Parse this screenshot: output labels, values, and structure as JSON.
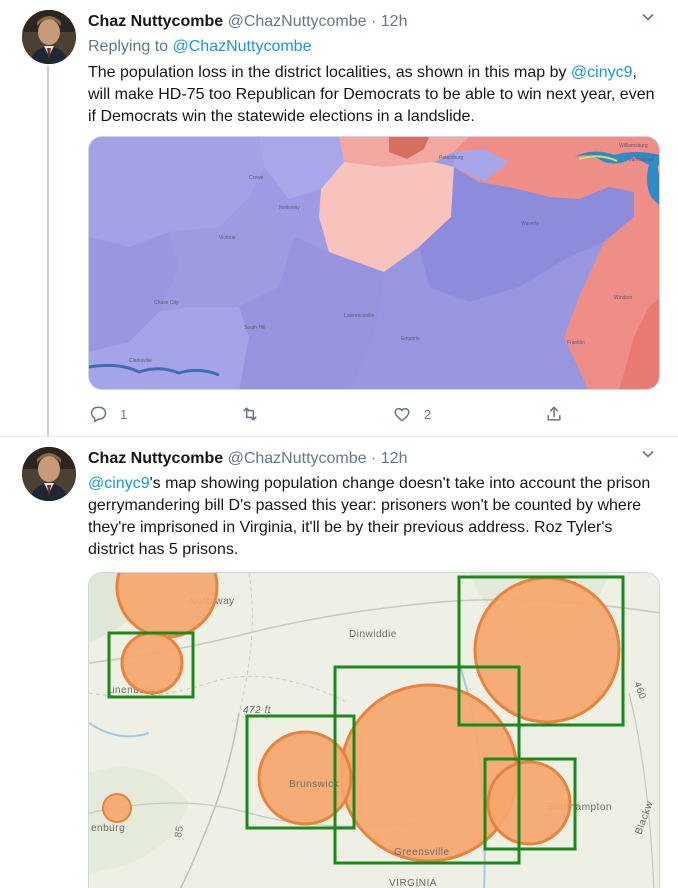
{
  "tweets": [
    {
      "name": "Chaz Nuttycombe",
      "handle": "@ChazNuttycombe",
      "dot": "·",
      "time": "12h",
      "reply_prefix": "Replying to",
      "reply_handle": "@ChazNuttycombe",
      "text_part1": "The population loss in the district localities, as shown in this map by",
      "text_mention": "@cinyc9",
      "text_part2": ", will make HD-75 too Republican for Democrats to be able to win next year, even if Democrats win the statewide elections in a landslide.",
      "map_labels": [
        "Petersburg",
        "Williamsburg",
        "Jamestown",
        "Crewe",
        "Nottoway",
        "Victoria",
        "Waverly",
        "Chase City",
        "Lawrenceville",
        "South Hill",
        "Windsor",
        "Emporia",
        "Franklin",
        "Clarksville"
      ],
      "reply_count": "1",
      "retweet_count": "",
      "like_count": "2"
    },
    {
      "name": "Chaz Nuttycombe",
      "handle": "@ChazNuttycombe",
      "dot": "·",
      "time": "12h",
      "text_mention": "@cinyc9",
      "text_part2": "'s map showing population change doesn't take into account the prison gerrymandering bill D's passed this year: prisoners won't be counted by where they're imprisoned in Virginia, it'll be by their previous address. Roz Tyler's district has 5 prisons.",
      "map_labels": [
        "Nottoway",
        "Dinwiddie",
        "unenburg",
        "472 ft",
        "Brunswick",
        "Southampton",
        "Greensville",
        "VIRGINIA",
        "enburg",
        "85",
        "460",
        "Blackw"
      ]
    }
  ],
  "colors": {
    "accent": "#1b95e0",
    "secondary_text": "#657786",
    "dem_blue": "#9b9ae4",
    "rep_red": "#ee8a84",
    "circle_fill": "#f6a66c",
    "circle_stroke": "#e8833f",
    "box_stroke": "#1b8a1b"
  },
  "icons": [
    "chevron-down-icon",
    "reply-icon",
    "retweet-icon",
    "like-icon",
    "share-icon"
  ]
}
